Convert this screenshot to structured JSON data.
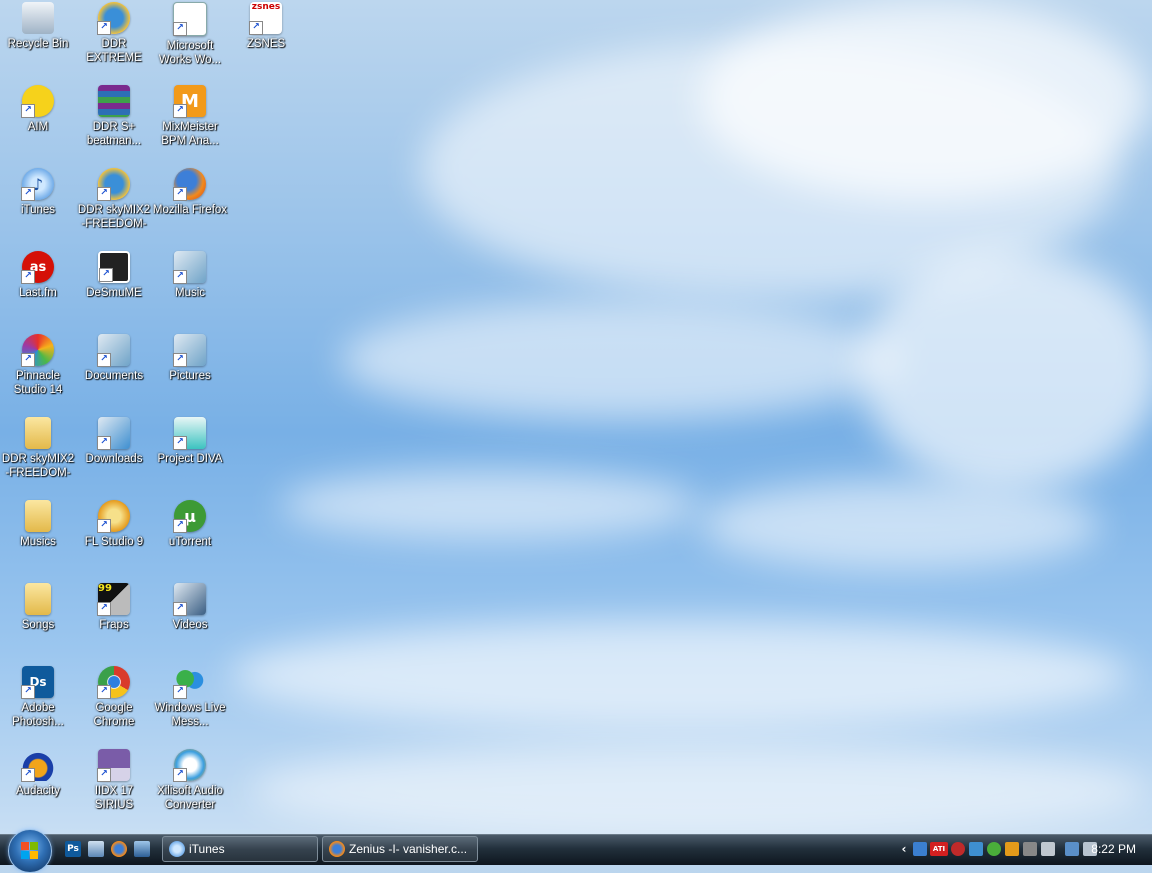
{
  "desktop": {
    "icons": [
      {
        "label": "Recycle Bin",
        "icon": "recycle-bin-icon"
      },
      {
        "label": "DDR EXTREME",
        "icon": "game-globe-icon"
      },
      {
        "label": "Microsoft Works Wo...",
        "icon": "document-icon"
      },
      {
        "label": "ZSNES",
        "icon": "zsnes-icon",
        "badge": "zsnes"
      },
      {
        "label": "AIM",
        "icon": "aim-running-man-icon"
      },
      {
        "label": "DDR S+ beatman...",
        "icon": "winrar-icon"
      },
      {
        "label": "MixMeister BPM Ana...",
        "icon": "mixmeister-icon",
        "badge": "M"
      },
      {
        "label": "iTunes",
        "icon": "itunes-icon"
      },
      {
        "label": "DDR skyMIX2 -FREEDOM-",
        "icon": "game-globe-icon"
      },
      {
        "label": "Mozilla Firefox",
        "icon": "firefox-icon"
      },
      {
        "label": "Last.fm",
        "icon": "lastfm-icon",
        "badge": "as"
      },
      {
        "label": "DeSmuME",
        "icon": "desmume-icon"
      },
      {
        "label": "Music",
        "icon": "music-folder-icon"
      },
      {
        "label": "Pinnacle Studio 14",
        "icon": "pinnacle-icon"
      },
      {
        "label": "Documents",
        "icon": "documents-folder-icon"
      },
      {
        "label": "Pictures",
        "icon": "pictures-folder-icon"
      },
      {
        "label": "DDR skyMIX2 -FREEDOM-",
        "icon": "folder-icon"
      },
      {
        "label": "Downloads",
        "icon": "downloads-folder-icon"
      },
      {
        "label": "Project DIVA",
        "icon": "project-diva-icon"
      },
      {
        "label": "Musics",
        "icon": "folder-icon"
      },
      {
        "label": "FL Studio 9",
        "icon": "fl-studio-icon"
      },
      {
        "label": "uTorrent",
        "icon": "utorrent-icon",
        "badge": "µ"
      },
      {
        "label": "Songs",
        "icon": "folder-icon"
      },
      {
        "label": "Fraps",
        "icon": "fraps-icon",
        "badge": "99"
      },
      {
        "label": "Videos",
        "icon": "videos-folder-icon"
      },
      {
        "label": "Adobe Photosh...",
        "icon": "photoshop-icon",
        "badge": "Ds"
      },
      {
        "label": "Google Chrome",
        "icon": "chrome-icon"
      },
      {
        "label": "Windows Live Mess...",
        "icon": "live-messenger-icon"
      },
      {
        "label": "Audacity",
        "icon": "audacity-icon"
      },
      {
        "label": "IIDX 17 SIRIUS",
        "icon": "floppy-disk-icon"
      },
      {
        "label": "Xilisoft Audio Converter",
        "icon": "xilisoft-icon"
      }
    ]
  },
  "taskbar": {
    "quick_launch": [
      {
        "icon": "photoshop-icon",
        "badge": "Ps"
      },
      {
        "icon": "show-desktop-icon",
        "badge": ""
      },
      {
        "icon": "firefox-icon",
        "badge": ""
      },
      {
        "icon": "switch-windows-icon",
        "badge": ""
      }
    ],
    "tasks": [
      {
        "label": "iTunes",
        "icon": "itunes-icon"
      },
      {
        "label": "Zenius -I- vanisher.c...",
        "icon": "firefox-icon"
      }
    ],
    "tray": {
      "icons": [
        "chevron-left-icon",
        "display-icon",
        "ati-icon",
        "security-icon",
        "network-users-icon",
        "green-user-icon",
        "user-status-icon",
        "disabled-icon",
        "volume-icon",
        "network-icon",
        "speaker-icon"
      ],
      "ati_badge": "ATI",
      "clock": "8:22 PM"
    }
  },
  "colors": {
    "sky_top": "#bcd6ee",
    "sky_mid": "#78b0e6",
    "taskbar": "#22303c"
  }
}
